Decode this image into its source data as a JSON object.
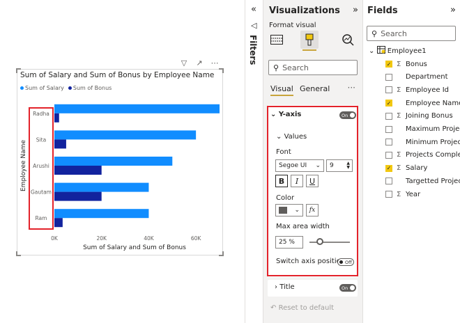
{
  "chart_data": {
    "type": "bar",
    "orientation": "horizontal",
    "title": "Sum of Salary and Sum of Bonus by Employee Name",
    "xlabel": "Sum of Salary and Sum of Bonus",
    "ylabel": "Employee Name",
    "categories": [
      "Radha",
      "Sita",
      "Arushi",
      "Gautam",
      "Ram"
    ],
    "series": [
      {
        "name": "Sum of Salary",
        "values": [
          70000,
          60000,
          50000,
          40000,
          40000
        ],
        "color": "#118dff"
      },
      {
        "name": "Sum of Bonus",
        "values": [
          2000,
          5000,
          20000,
          20000,
          3500
        ],
        "color": "#12239e"
      }
    ],
    "x_ticks": [
      "0K",
      "20K",
      "40K",
      "60K"
    ],
    "xlim": [
      0,
      70000
    ],
    "grid": false,
    "legend_position": "top-left"
  },
  "filters": {
    "label": "Filters",
    "collapse_icon": "double-chevron-left-icon"
  },
  "viz_pane": {
    "title": "Visualizations",
    "format_label": "Format visual",
    "search_placeholder": "Search",
    "tabs": [
      "Visual",
      "General"
    ],
    "more": "···",
    "yaxis": {
      "title": "Y-axis",
      "toggle": "On",
      "values_header": "Values",
      "font_label": "Font",
      "font_family": "Segoe UI",
      "font_size": "9",
      "bold": "B",
      "italic": "I",
      "underline": "U",
      "color_label": "Color",
      "color": "#605e5c",
      "fx": "fx",
      "max_width_label": "Max area width",
      "max_width_value": "25",
      "max_width_unit": "%",
      "max_width_fraction": 0.25,
      "switch_label": "Switch axis position",
      "switch_toggle": "Off"
    },
    "title_section": {
      "title": "Title",
      "toggle": "On"
    },
    "reset": "Reset to default"
  },
  "fields_pane": {
    "title": "Fields",
    "search_placeholder": "Search",
    "table": "Employee1",
    "fields": [
      {
        "name": "Bonus",
        "sigma": true,
        "checked": true
      },
      {
        "name": "Department",
        "sigma": false,
        "checked": false
      },
      {
        "name": "Employee Id",
        "sigma": true,
        "checked": false
      },
      {
        "name": "Employee Name",
        "sigma": false,
        "checked": true
      },
      {
        "name": "Joining Bonus",
        "sigma": true,
        "checked": false
      },
      {
        "name": "Maximum Projects",
        "sigma": false,
        "checked": false
      },
      {
        "name": "Minimum Projects",
        "sigma": false,
        "checked": false
      },
      {
        "name": "Projects Complet...",
        "sigma": true,
        "checked": false
      },
      {
        "name": "Salary",
        "sigma": true,
        "checked": true
      },
      {
        "name": "Targetted Projects",
        "sigma": false,
        "checked": false
      },
      {
        "name": "Year",
        "sigma": true,
        "checked": false
      }
    ]
  }
}
